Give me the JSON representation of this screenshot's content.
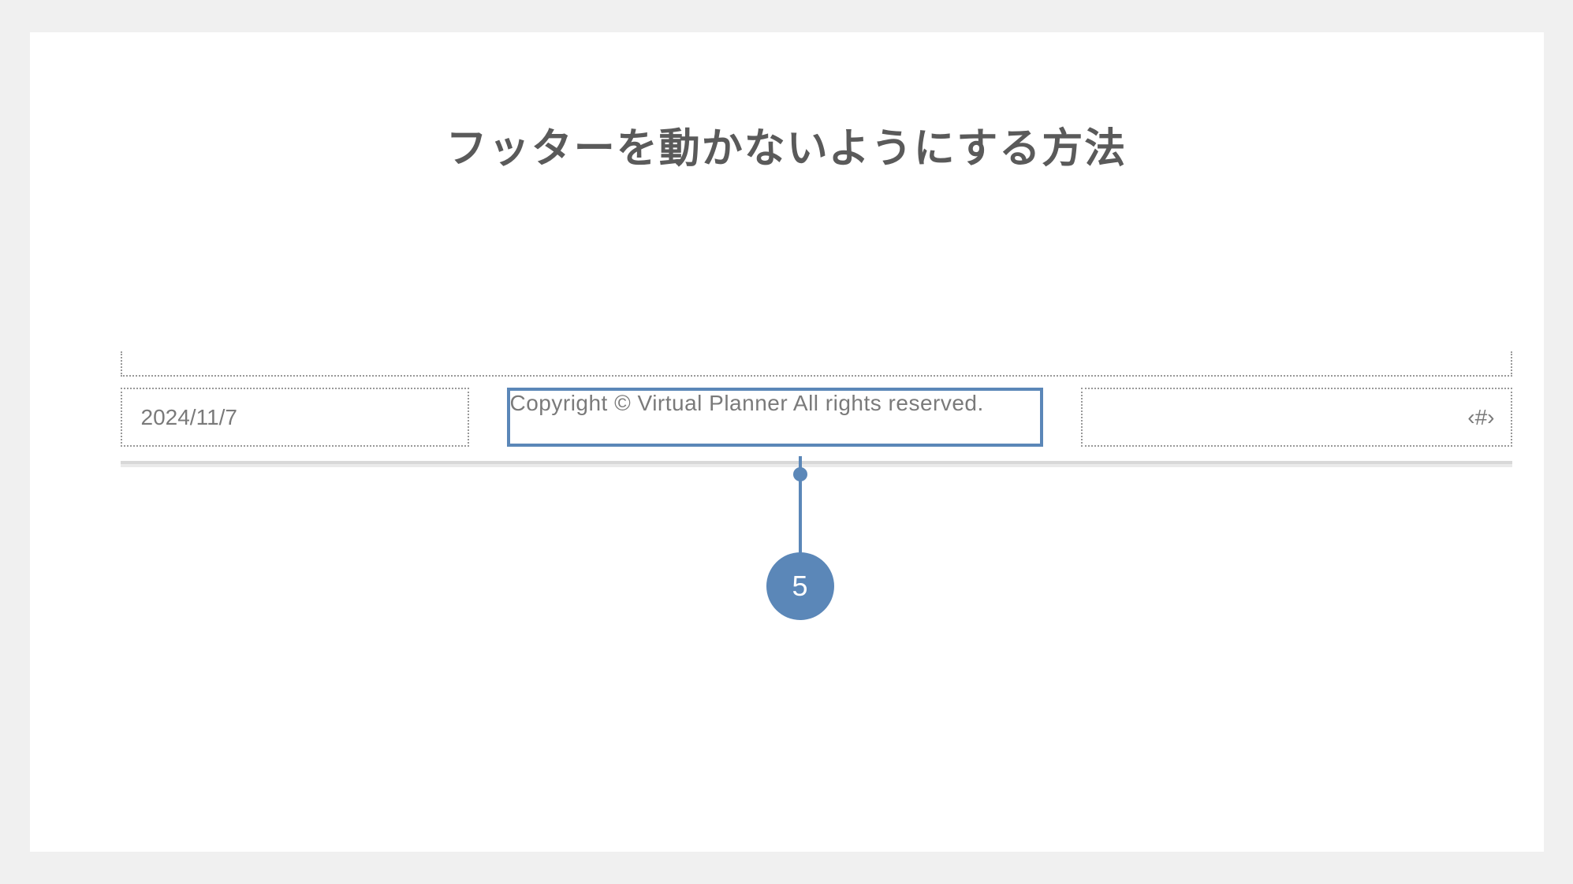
{
  "title": "フッターを動かないようにする方法",
  "footer": {
    "date": "2024/11/7",
    "copyright": "Copyright © Virtual Planner All rights reserved.",
    "page_number_placeholder": "‹#›"
  },
  "callout": {
    "number": "5"
  },
  "colors": {
    "accent": "#5b87b8",
    "title_text": "#5a5a5a",
    "footer_text": "#7a7a7a",
    "dotted_border": "#999999"
  }
}
